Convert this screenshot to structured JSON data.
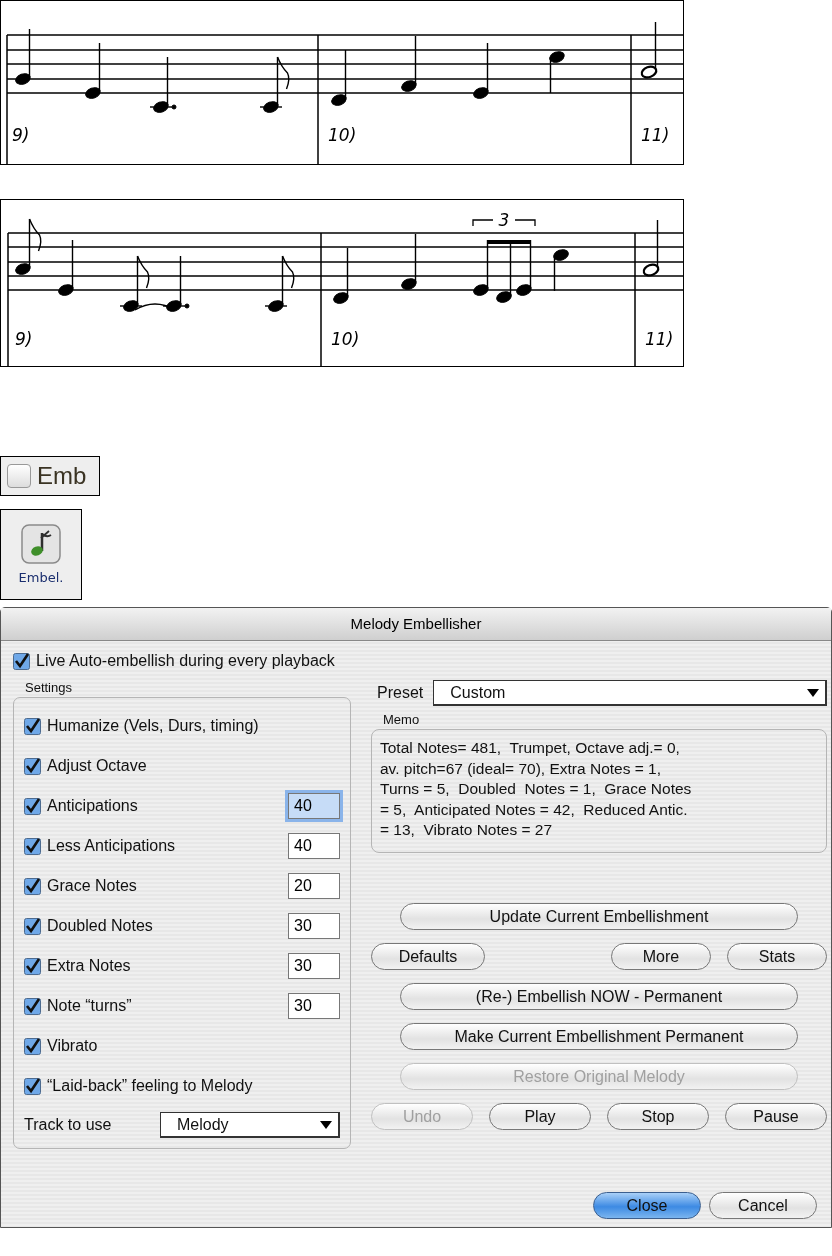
{
  "scores": [
    {
      "measures": [
        "9)",
        "10)",
        "11)"
      ]
    },
    {
      "measures": [
        "9)",
        "10)",
        "11)"
      ],
      "tuplet": "3"
    }
  ],
  "emb_checkbox": {
    "label": "Emb",
    "checked": false
  },
  "embel_button": {
    "label": "Embel."
  },
  "dialog": {
    "title": "Melody Embellisher",
    "live": {
      "label": "Live Auto-embellish during every playback",
      "checked": true
    },
    "settings_label": "Settings",
    "settings": [
      {
        "label": "Humanize (Vels, Durs, timing)",
        "checked": true
      },
      {
        "label": "Adjust Octave",
        "checked": true
      },
      {
        "label": "Anticipations",
        "checked": true,
        "value": "40",
        "focused": true
      },
      {
        "label": "Less Anticipations",
        "checked": true,
        "value": "40",
        "focused": false
      },
      {
        "label": "Grace Notes",
        "checked": true,
        "value": "20",
        "focused": false
      },
      {
        "label": "Doubled Notes",
        "checked": true,
        "value": "30",
        "focused": false
      },
      {
        "label": "Extra Notes",
        "checked": true,
        "value": "30",
        "focused": false
      },
      {
        "label": "Note “turns”",
        "checked": true,
        "value": "30",
        "focused": false
      },
      {
        "label": "Vibrato",
        "checked": true
      },
      {
        "label": "“Laid-back” feeling to Melody",
        "checked": true
      }
    ],
    "track": {
      "label": "Track to use",
      "value": "Melody"
    },
    "preset": {
      "label": "Preset",
      "value": "Custom"
    },
    "memo": {
      "label": "Memo",
      "text": "Total Notes= 481,  Trumpet, Octave adj.= 0,\nav. pitch=67 (ideal= 70), Extra Notes = 1,\nTurns = 5,  Doubled  Notes = 1,  Grace Notes\n= 5,  Anticipated Notes = 42,  Reduced Antic.\n= 13,  Vibrato Notes = 27"
    },
    "button_rows": [
      {
        "buttons": [
          {
            "label": "Update Current Embellishment",
            "disabled": false
          }
        ]
      },
      {
        "buttons": [
          {
            "label": "Defaults",
            "disabled": false
          },
          {
            "label": "More",
            "disabled": false
          },
          {
            "label": "Stats",
            "disabled": false
          }
        ]
      },
      {
        "buttons": [
          {
            "label": "(Re-) Embellish NOW - Permanent",
            "disabled": false
          }
        ]
      },
      {
        "buttons": [
          {
            "label": "Make Current Embellishment Permanent",
            "disabled": false
          }
        ]
      },
      {
        "buttons": [
          {
            "label": "Restore Original Melody",
            "disabled": true
          }
        ]
      },
      {
        "buttons": [
          {
            "label": "Undo",
            "disabled": true
          },
          {
            "label": "Play",
            "disabled": false
          },
          {
            "label": "Stop",
            "disabled": false
          },
          {
            "label": "Pause",
            "disabled": false
          }
        ]
      }
    ],
    "footer_buttons": [
      {
        "label": "Close",
        "kind": "default"
      },
      {
        "label": "Cancel",
        "kind": "normal"
      }
    ]
  }
}
